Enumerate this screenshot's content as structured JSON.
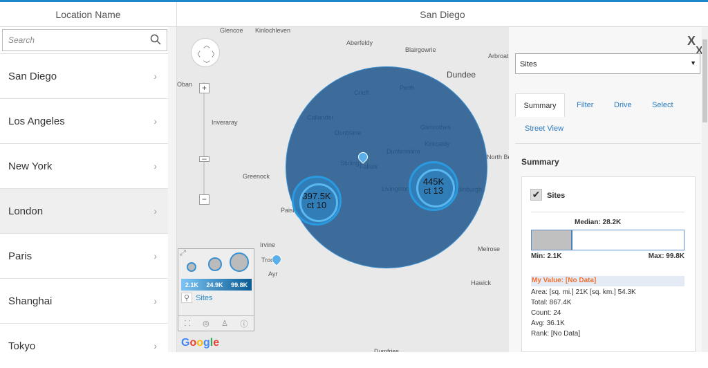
{
  "header": {
    "left_title": "Location Name",
    "map_title": "San Diego"
  },
  "search": {
    "placeholder": "Search"
  },
  "locations": [
    {
      "label": "San Diego"
    },
    {
      "label": "Los Angeles"
    },
    {
      "label": "New York"
    },
    {
      "label": "London",
      "selected": true
    },
    {
      "label": "Paris"
    },
    {
      "label": "Shanghai"
    },
    {
      "label": "Tokyo"
    }
  ],
  "map": {
    "places": [
      "Glencoe",
      "Kinlochleven",
      "Aberfeldy",
      "Blairgowrie",
      "Arbroath",
      "Dundee",
      "Perth",
      "Crieff",
      "Callander",
      "Inveraray",
      "Dunblane",
      "Glenrothes",
      "Kirkcaldy",
      "Stirling",
      "Dunfermline",
      "Falkirk",
      "Greenock",
      "Livingston",
      "Edinburgh",
      "North Berwick",
      "Paisley",
      "Irvine",
      "Troon",
      "Ayr",
      "Melrose",
      "Hawick",
      "Dumfries",
      "Oban"
    ],
    "clusters": [
      {
        "value": "397.5K",
        "count": "ct 10"
      },
      {
        "value": "445K",
        "count": "ct 13"
      }
    ],
    "legend": {
      "values": [
        "2.1K",
        "24.9K",
        "99.8K"
      ],
      "layer": "Sites"
    },
    "attribution": "Google"
  },
  "panel": {
    "layer_select": "Sites",
    "tabs": [
      "Summary",
      "Filter",
      "Drive",
      "Select",
      "Street View"
    ],
    "summary_title": "Summary",
    "layer_name": "Sites",
    "median": "Median: 28.2K",
    "median_fraction": 0.27,
    "min": "Min: 2.1K",
    "max": "Max: 99.8K",
    "my_value": "My Value: [No Data]",
    "stats": [
      "Area: [sq. mi.] 21K [sq. km.] 54.3K",
      "Total: 867.4K",
      "Count: 24",
      "Avg: 36.1K",
      "Rank: [No Data]"
    ],
    "close": "X"
  }
}
